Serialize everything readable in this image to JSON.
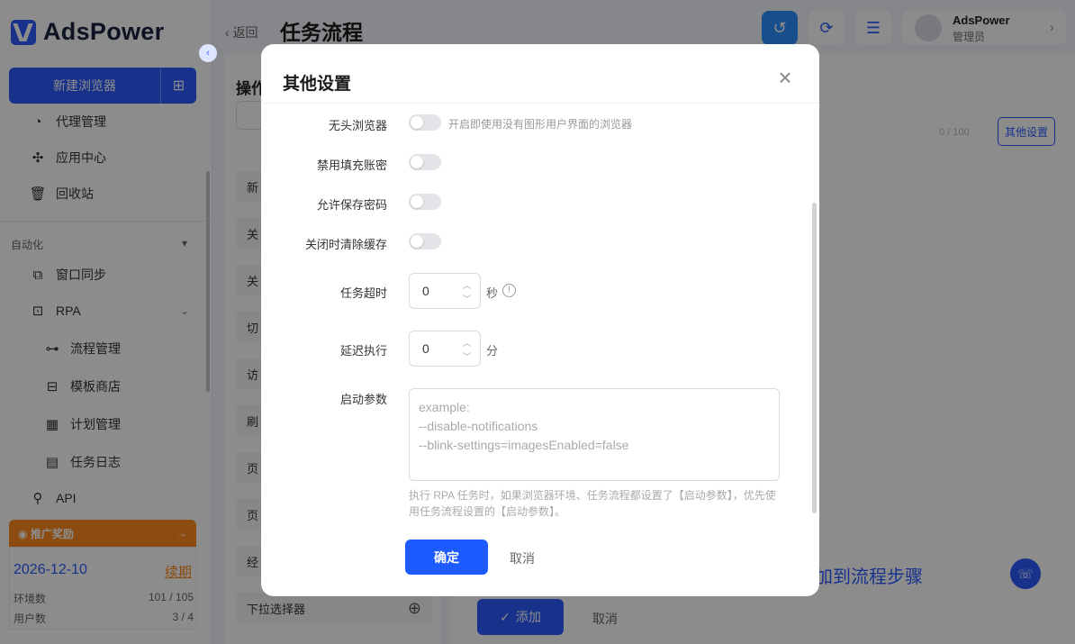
{
  "sidebar": {
    "logo_text": "AdsPower",
    "new_browser_label": "新建浏览器",
    "items": [
      {
        "label": "代理管理",
        "icon": "proxy-icon"
      },
      {
        "label": "应用中心",
        "icon": "puzzle-icon"
      },
      {
        "label": "回收站",
        "icon": "trash-icon"
      }
    ],
    "automation_section": "自动化",
    "automation_items": [
      {
        "label": "窗口同步",
        "icon": "window-sync-icon"
      },
      {
        "label": "RPA",
        "icon": "robot-icon"
      },
      {
        "label": "流程管理",
        "icon": "flow-icon"
      },
      {
        "label": "模板商店",
        "icon": "store-icon"
      },
      {
        "label": "计划管理",
        "icon": "calendar-icon"
      },
      {
        "label": "任务日志",
        "icon": "log-icon"
      },
      {
        "label": "API",
        "icon": "api-icon"
      }
    ],
    "promo": {
      "title": "推广奖励",
      "date": "2026-12-10",
      "renew": "续期",
      "env_label": "环境数",
      "env_value": "101 / 105",
      "user_label": "用户数",
      "user_value": "3 / 4"
    }
  },
  "header": {
    "back": "返回",
    "title": "任务流程",
    "user_name": "AdsPower",
    "user_role": "管理员"
  },
  "middle": {
    "title": "操作",
    "items": [
      "新",
      "关",
      "关",
      "切",
      "访",
      "刷",
      "页",
      "页",
      "经",
      "下拉选择器"
    ]
  },
  "right": {
    "other_settings": "其他设置",
    "counter": "0 / 100",
    "add": "添加",
    "cancel": "取消",
    "helper": "加到流程步骤"
  },
  "modal": {
    "title": "其他设置",
    "headless_label": "无头浏览器",
    "headless_hint": "开启即使用没有图形用户界面的浏览器",
    "disable_fill_label": "禁用填充账密",
    "allow_save_label": "允许保存密码",
    "clear_cache_label": "关闭时清除缓存",
    "timeout_label": "任务超时",
    "timeout_value": "0",
    "timeout_unit": "秒",
    "delay_label": "延迟执行",
    "delay_value": "0",
    "delay_unit": "分",
    "params_label": "启动参数",
    "params_placeholder": "example:\n--disable-notifications\n--blink-settings=imagesEnabled=false",
    "params_note": "执行 RPA 任务时，如果浏览器环境、任务流程都设置了【启动参数】，优先使用任务流程设置的【启动参数】。",
    "confirm": "确定",
    "cancel": "取消"
  }
}
